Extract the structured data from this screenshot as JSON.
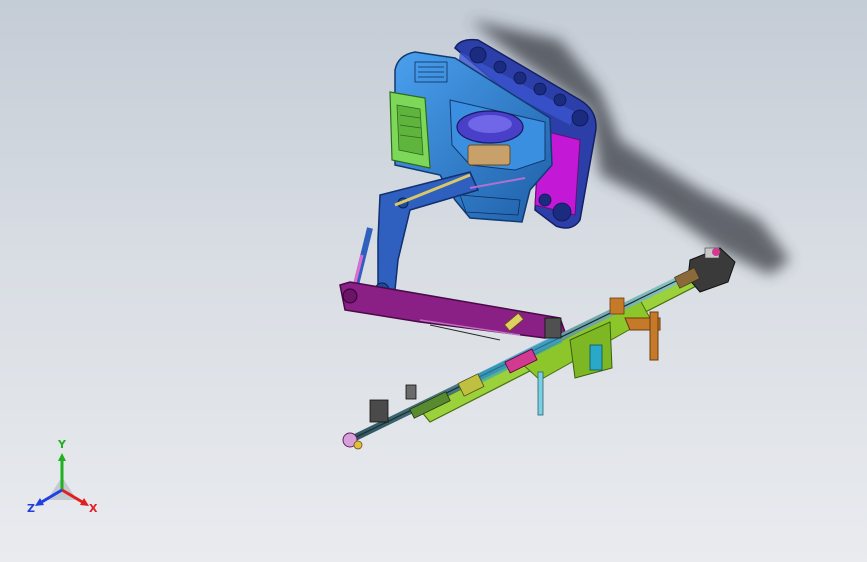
{
  "viewport": {
    "background_top": "#c4ccd6",
    "background_bottom": "#e9ebef"
  },
  "model": {
    "parts": [
      "cab-body",
      "cab-door",
      "seat",
      "track-assembly",
      "track-roller",
      "boom-arm",
      "hydraulic-cylinder",
      "lower-arm",
      "drill-feed-rail",
      "drill-rod",
      "rear-support-leg",
      "drill-head",
      "front-coupling"
    ],
    "colors": {
      "cab": "#2e86d8",
      "cab_dark": "#1f5fa8",
      "door": "#7dd85a",
      "track": "#2c3fa8",
      "track_side": "#c318d6",
      "boom": "#2f5fbf",
      "lower_arm": "#8a1f86",
      "feed_rail": "#9bd13a",
      "rod": "#3f6b7a",
      "support": "#c57a2a",
      "shadow": "#3a3d44"
    }
  },
  "triad": {
    "x_label": "X",
    "y_label": "Y",
    "z_label": "Z",
    "x_color": "#e02020",
    "y_color": "#20b020",
    "z_color": "#2040e0"
  }
}
